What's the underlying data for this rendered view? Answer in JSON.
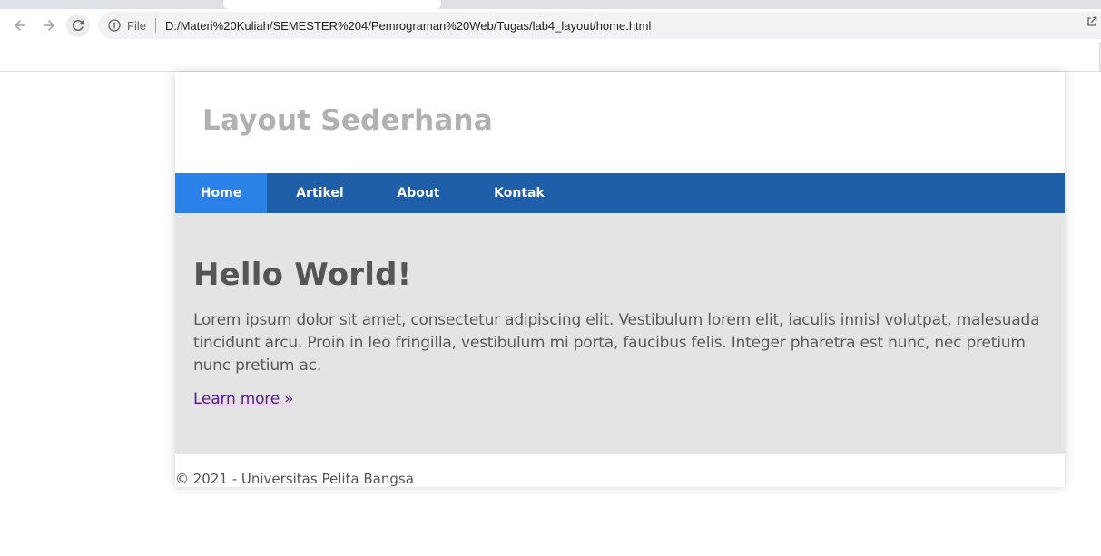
{
  "browser": {
    "back_icon": "arrow-left-icon",
    "forward_icon": "arrow-right-icon",
    "reload_icon": "reload-icon",
    "info_icon": "info-icon",
    "scheme_label": "File",
    "url": "D:/Materi%20Kuliah/SEMESTER%204/Pemrograman%20Web/Tugas/lab4_layout/home.html",
    "share_icon": "share-icon"
  },
  "site": {
    "title": "Layout Sederhana",
    "nav": [
      {
        "label": "Home",
        "active": true
      },
      {
        "label": "Artikel",
        "active": false
      },
      {
        "label": "About",
        "active": false
      },
      {
        "label": "Kontak",
        "active": false
      }
    ],
    "hero": {
      "title": "Hello World!",
      "text": "Lorem ipsum dolor sit amet, consectetur adipiscing elit. Vestibulum lorem elit, iaculis innisl volutpat, malesuada tincidunt arcu. Proin in leo fringilla, vestibulum mi porta, faucibus felis. Integer pharetra est nunc, nec pretium nunc pretium ac.",
      "link": "Learn more »"
    },
    "footer": "© 2021 - Universitas Pelita Bangsa"
  },
  "colors": {
    "nav_bg": "#1f5faa",
    "nav_active": "#2b83ea",
    "hero_bg": "#e4e4e4",
    "title": "#b1b1b1",
    "link": "#551a8b"
  }
}
